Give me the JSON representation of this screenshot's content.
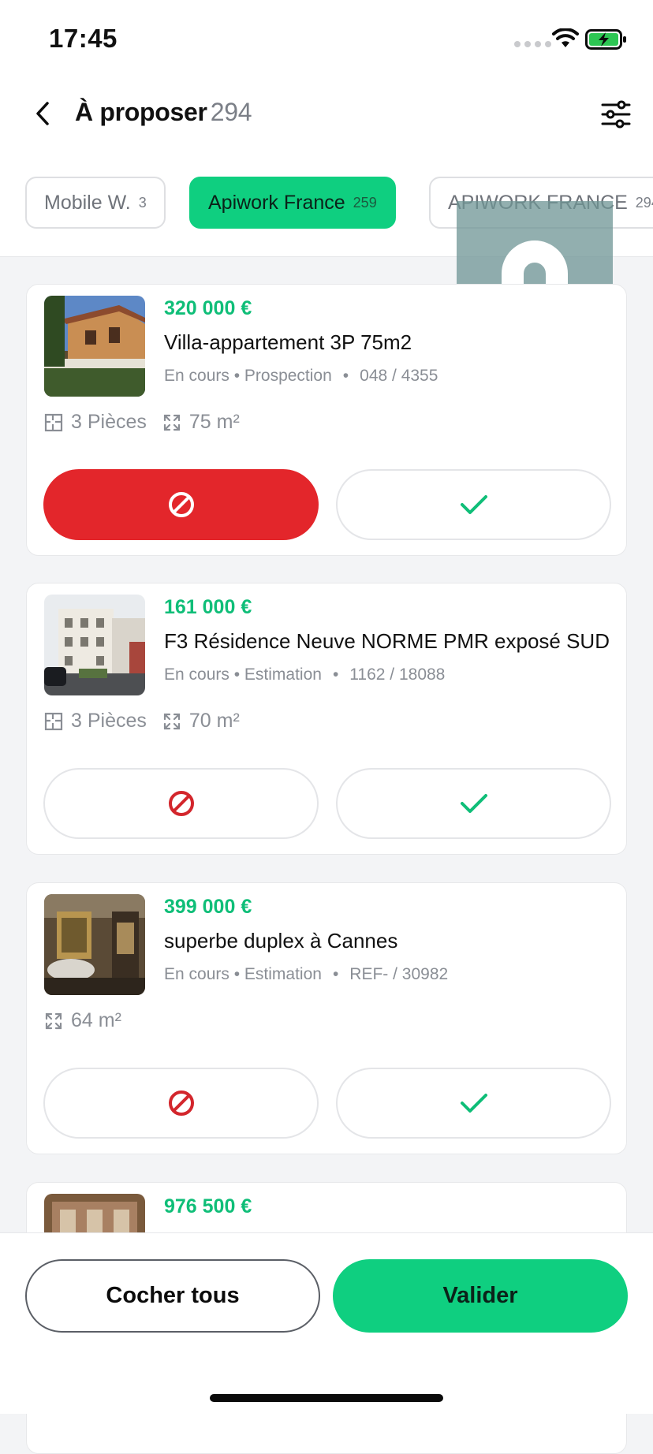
{
  "status_bar": {
    "time": "17:45"
  },
  "header": {
    "title": "À proposer",
    "count": "294"
  },
  "chips": [
    {
      "label": "Mobile W.",
      "count": "3"
    },
    {
      "label": "Apiwork France",
      "count": "259"
    },
    {
      "label": "APIWORK FRANCE",
      "count": "294"
    }
  ],
  "listings": [
    {
      "price": "320 000 €",
      "title": "Villa-appartement 3P 75m2",
      "status": "En cours • Prospection",
      "ref": "048 / 4355",
      "rooms": "3 Pièces",
      "area": "75 m²"
    },
    {
      "price": "161 000 €",
      "title": "F3 Résidence Neuve NORME PMR exposé SUD",
      "status": "En cours • Estimation",
      "ref": "1162 / 18088",
      "rooms": "3 Pièces",
      "area": "70 m²"
    },
    {
      "price": "399 000 €",
      "title": "superbe duplex à Cannes",
      "status": "En cours • Estimation",
      "ref": "REF- / 30982",
      "area": "64 m²"
    },
    {
      "price": "976 500 €"
    }
  ],
  "bottom": {
    "check_all_label": "Cocher tous",
    "validate_label": "Valider"
  },
  "colors": {
    "accent_green": "#0fcf80",
    "reject_red": "#e3262b",
    "price_green": "#0fbe78"
  },
  "icons": [
    "back-arrow-icon",
    "filter-sliders-icon",
    "floor-plan-icon",
    "area-expand-icon",
    "ban-icon",
    "check-icon",
    "wifi-icon",
    "battery-icon"
  ]
}
